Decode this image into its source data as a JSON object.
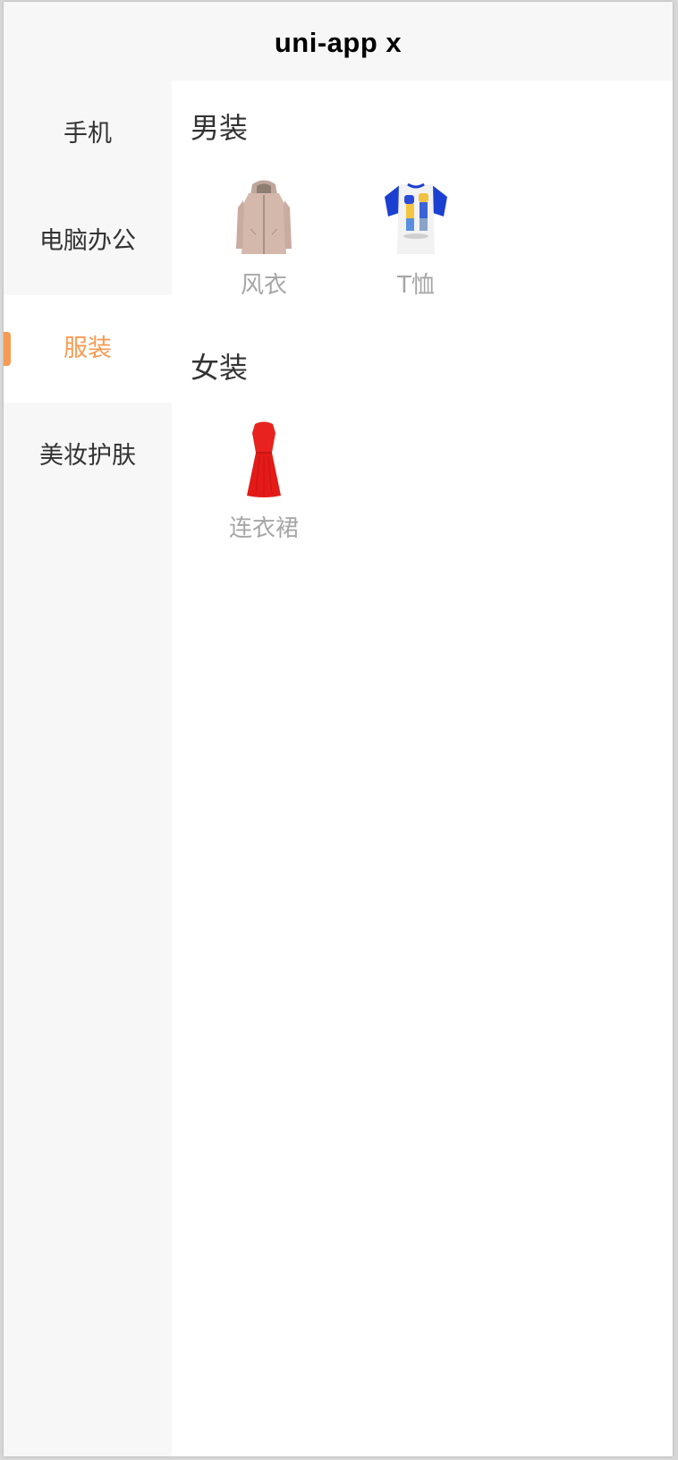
{
  "header": {
    "title": "uni-app x"
  },
  "sidebar": {
    "active_index": 2,
    "items": [
      {
        "label": "手机"
      },
      {
        "label": "电脑办公"
      },
      {
        "label": "服装"
      },
      {
        "label": "美妆护肤"
      }
    ]
  },
  "content": {
    "sections": [
      {
        "title": "男装",
        "products": [
          {
            "name": "风衣",
            "icon": "trench-coat-image"
          },
          {
            "name": "T恤",
            "icon": "tshirt-image"
          }
        ]
      },
      {
        "title": "女装",
        "products": [
          {
            "name": "连衣裙",
            "icon": "dress-image"
          }
        ]
      }
    ]
  },
  "colors": {
    "accent": "#f79a52",
    "sidebar_bg": "#f7f7f7",
    "header_bg": "#f7f7f7",
    "product_label": "#a6a6a6",
    "text": "#333333"
  }
}
